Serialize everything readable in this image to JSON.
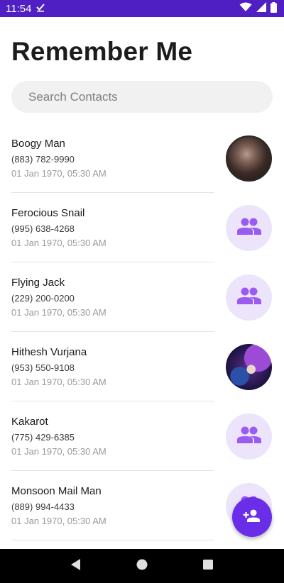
{
  "status_bar": {
    "time": "11:54",
    "icons": [
      "download-done-icon",
      "wifi-icon",
      "signal-icon",
      "battery-icon"
    ],
    "background": "#4f1fc4"
  },
  "header": {
    "title": "Remember Me"
  },
  "search": {
    "placeholder": "Search Contacts",
    "value": ""
  },
  "contacts": [
    {
      "name": "Boogy Man",
      "phone": "(883) 782-9990",
      "date": "01 Jan 1970, 05:30 AM",
      "avatar": "photo"
    },
    {
      "name": "Ferocious Snail",
      "phone": "(995) 638-4268",
      "date": "01 Jan 1970, 05:30 AM",
      "avatar": "group-icon"
    },
    {
      "name": "Flying Jack",
      "phone": "(229) 200-0200",
      "date": "01 Jan 1970, 05:30 AM",
      "avatar": "group-icon"
    },
    {
      "name": "Hithesh Vurjana",
      "phone": "(953) 550-9108",
      "date": "01 Jan 1970, 05:30 AM",
      "avatar": "photo"
    },
    {
      "name": "Kakarot",
      "phone": "(775) 429-6385",
      "date": "01 Jan 1970, 05:30 AM",
      "avatar": "group-icon"
    },
    {
      "name": "Monsoon Mail Man",
      "phone": "(889) 994-4433",
      "date": "01 Jan 1970, 05:30 AM",
      "avatar": "group-icon"
    }
  ],
  "fab": {
    "icon": "add-person-icon"
  },
  "colors": {
    "accent": "#6a2ee8",
    "avatar_placeholder": "#ece4fb",
    "avatar_icon": "#9a5cf0"
  },
  "nav_bar": {
    "icons": [
      "back-icon",
      "home-icon",
      "recents-icon"
    ]
  }
}
